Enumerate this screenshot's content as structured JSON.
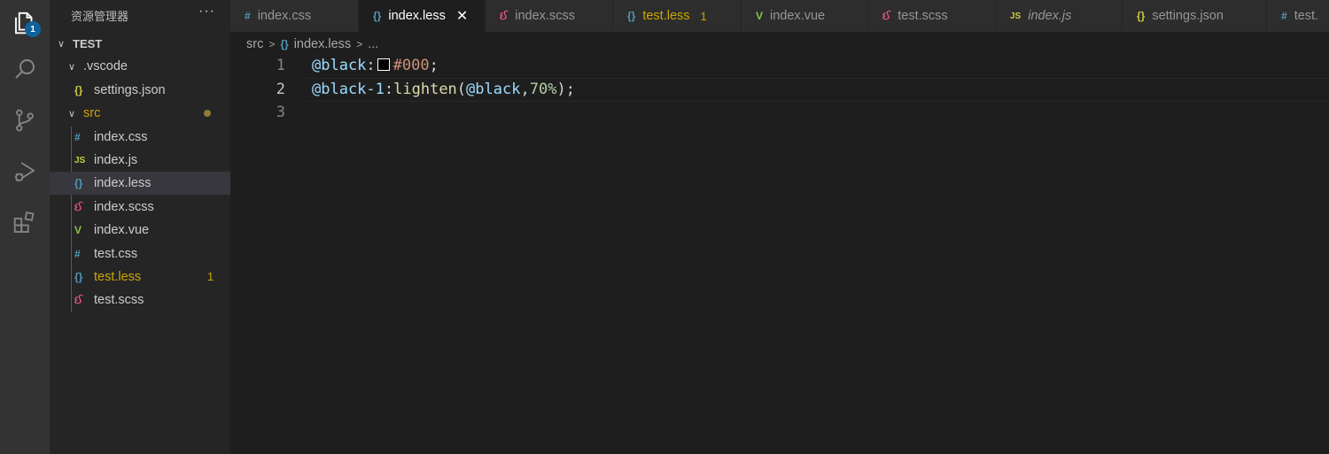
{
  "activity_bar": {
    "explorer_badge": "1",
    "items": [
      {
        "icon": "files-icon"
      },
      {
        "icon": "search-icon"
      },
      {
        "icon": "source-control-icon"
      },
      {
        "icon": "run-debug-icon"
      },
      {
        "icon": "extensions-icon"
      }
    ]
  },
  "sidebar": {
    "title": "资源管理器",
    "more": "···",
    "root": "TEST",
    "vscode_folder": ".vscode",
    "settings_file": "settings.json",
    "src_folder": "src",
    "files": [
      {
        "icon_glyph": "#",
        "name": "index.css"
      },
      {
        "icon_glyph": "JS",
        "name": "index.js"
      },
      {
        "icon_glyph": "{}",
        "name": "index.less"
      },
      {
        "icon_glyph": "ઈ",
        "name": "index.scss"
      },
      {
        "icon_glyph": "V",
        "name": "index.vue"
      },
      {
        "icon_glyph": "#",
        "name": "test.css"
      },
      {
        "icon_glyph": "{}",
        "name": "test.less",
        "problems": "1"
      },
      {
        "icon_glyph": "ઈ",
        "name": "test.scss"
      }
    ]
  },
  "tabs": [
    {
      "icon_glyph": "#",
      "label": "index.css"
    },
    {
      "icon_glyph": "{}",
      "label": "index.less",
      "close": "✕"
    },
    {
      "icon_glyph": "ઈ",
      "label": "index.scss"
    },
    {
      "icon_glyph": "{}",
      "label": "test.less",
      "problems": "1"
    },
    {
      "icon_glyph": "V",
      "label": "index.vue"
    },
    {
      "icon_glyph": "ઈ",
      "label": "test.scss"
    },
    {
      "icon_glyph": "JS",
      "label": "index.js"
    },
    {
      "icon_glyph": "{}",
      "label": "settings.json"
    },
    {
      "icon_glyph": "#",
      "label": "test."
    }
  ],
  "breadcrumb": {
    "folder": "src",
    "file_icon": "{}",
    "file": "index.less",
    "ellipsis": "..."
  },
  "editor": {
    "line_numbers": [
      "1",
      "2",
      "3"
    ],
    "line1": {
      "var": "@black",
      "colon": ":",
      "value": "#000",
      "semi": ";"
    },
    "line2": {
      "var": "@black-1",
      "colon": ":",
      "fn": "lighten",
      "open": "(",
      "arg": "@black",
      "comma": ",",
      "num": "70%",
      "close": ")",
      "semi": ";"
    }
  },
  "colors": {
    "activity_bg": "#333333",
    "sidebar_bg": "#252526",
    "editor_bg": "#1e1e1e",
    "badge": "#0e639c",
    "warning": "#cca700",
    "swatch": "#000000"
  }
}
